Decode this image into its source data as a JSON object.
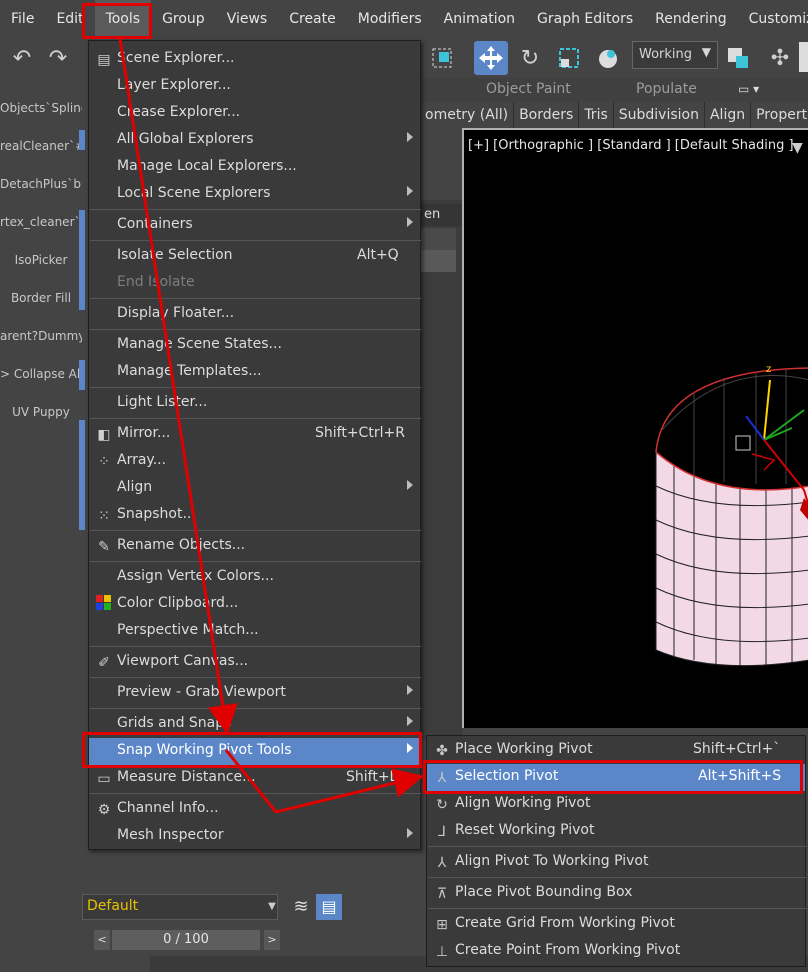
{
  "menubar": {
    "items": [
      "File",
      "Edit",
      "Tools",
      "Group",
      "Views",
      "Create",
      "Modifiers",
      "Animation",
      "Graph Editors",
      "Rendering",
      "Customize"
    ]
  },
  "toolbar": {
    "coord_system": "Working"
  },
  "left_panel": {
    "items": [
      "Objects`Spline",
      "realCleaner`#",
      "DetachPlus`b",
      "rtex_cleaner`",
      "IsoPicker",
      "Border Fill",
      "arent?Dummy",
      "> Collapse All",
      "UV Puppy"
    ]
  },
  "ribbon": {
    "group_label_1": "Object Paint",
    "group_label_2": "Populate",
    "tabs": [
      "ometry (All)",
      "Borders",
      "Tris",
      "Subdivision",
      "Align",
      "Propert"
    ]
  },
  "scene_explorer": {
    "header": "en"
  },
  "viewport": {
    "label": "[+] [Orthographic ] [Standard ] [Default Shading ]",
    "axis_z": "z"
  },
  "tools_menu": {
    "items": [
      {
        "label": "Scene Explorer...",
        "icon": "table-icon"
      },
      {
        "label": "Layer Explorer..."
      },
      {
        "label": "Crease Explorer..."
      },
      {
        "label": "All Global Explorers",
        "submenu": true
      },
      {
        "label": "Manage Local Explorers..."
      },
      {
        "label": "Local Scene Explorers",
        "submenu": true
      },
      {
        "label": "Containers",
        "submenu": true
      },
      {
        "label": "Isolate Selection",
        "shortcut": "Alt+Q"
      },
      {
        "label": "End Isolate",
        "disabled": true
      },
      {
        "label": "Display Floater..."
      },
      {
        "label": "Manage Scene States..."
      },
      {
        "label": "Manage Templates..."
      },
      {
        "label": "Light Lister..."
      },
      {
        "label": "Mirror...",
        "shortcut": "Shift+Ctrl+R",
        "icon": "mirror-icon"
      },
      {
        "label": "Array...",
        "icon": "array-icon"
      },
      {
        "label": "Align",
        "submenu": true
      },
      {
        "label": "Snapshot...",
        "icon": "snapshot-icon"
      },
      {
        "label": "Rename Objects...",
        "icon": "rename-icon"
      },
      {
        "label": "Assign Vertex Colors..."
      },
      {
        "label": "Color Clipboard...",
        "icon": "color-clipboard-icon"
      },
      {
        "label": "Perspective Match..."
      },
      {
        "label": "Viewport Canvas...",
        "icon": "brush-icon"
      },
      {
        "label": "Preview - Grab Viewport",
        "submenu": true
      },
      {
        "label": "Grids and Snaps",
        "submenu": true
      },
      {
        "label": "Snap Working Pivot Tools",
        "submenu": true,
        "highlighted": true
      },
      {
        "label": "Measure Distance...",
        "shortcut": "Shift+D",
        "icon": "measure-icon"
      },
      {
        "label": "Channel Info...",
        "icon": "channel-icon"
      },
      {
        "label": "Mesh Inspector",
        "submenu": true
      }
    ]
  },
  "submenu": {
    "items": [
      {
        "label": "Place Working Pivot",
        "shortcut": "Shift+Ctrl+`",
        "icon": "place-pivot-icon"
      },
      {
        "label": "Selection Pivot",
        "shortcut": "Alt+Shift+S",
        "icon": "selection-pivot-icon",
        "highlighted": true
      },
      {
        "label": "Align Working Pivot",
        "icon": "align-pivot-icon"
      },
      {
        "label": "Reset Working Pivot",
        "icon": "reset-pivot-icon"
      },
      {
        "label": "Align Pivot To Working Pivot",
        "icon": "align-to-pivot-icon"
      },
      {
        "label": "Place Pivot Bounding Box",
        "icon": "bounding-box-icon"
      },
      {
        "label": "Create Grid From Working Pivot",
        "icon": "grid-icon"
      },
      {
        "label": "Create Point From Working Pivot",
        "icon": "point-icon"
      }
    ]
  },
  "bottom": {
    "layer": "Default",
    "time": "0 / 100"
  },
  "colors": {
    "highlight": "#5b87c8",
    "annotation": "#e00000",
    "cylinder": "#f3d9e6"
  }
}
